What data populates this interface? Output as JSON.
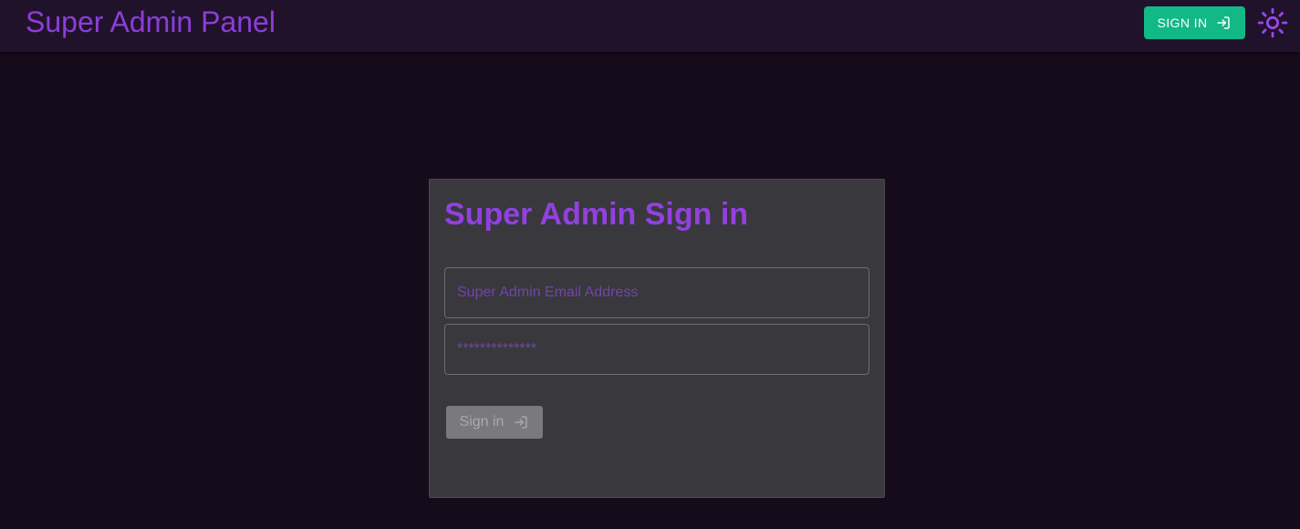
{
  "header": {
    "title": "Super Admin Panel",
    "sign_in_label": "SIGN IN",
    "sign_in_icon": "login-icon",
    "theme_icon": "sun-icon"
  },
  "login": {
    "title": "Super Admin Sign in",
    "email_placeholder": "Super Admin Email Address",
    "email_value": "",
    "password_placeholder": "**************",
    "password_value": "",
    "submit_label": "Sign in",
    "submit_icon": "login-icon",
    "submit_disabled": true
  },
  "colors": {
    "background": "#160b1b",
    "header_background": "#21122b",
    "accent_purple": "#8b3ed8",
    "sign_in_green": "#12b886",
    "card_background": "#39383d",
    "disabled_button": "#7a797e"
  }
}
